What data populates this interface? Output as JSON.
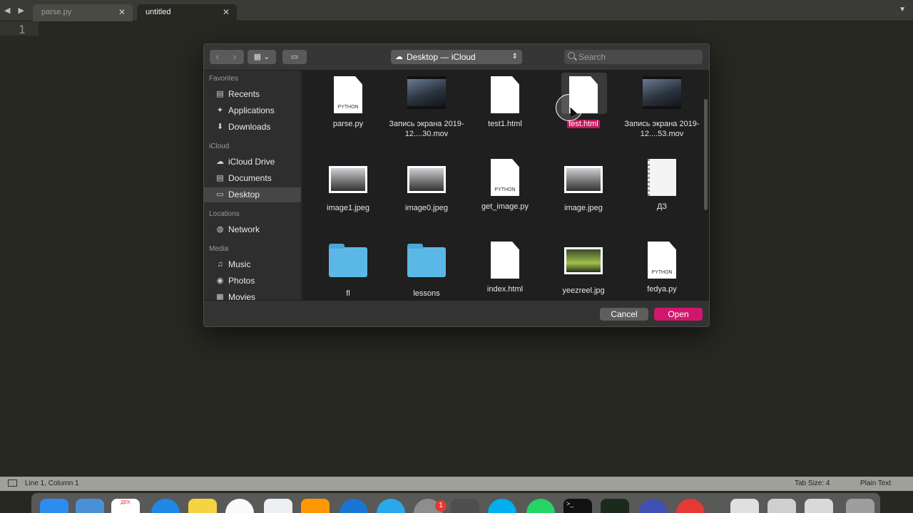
{
  "editor": {
    "tabs": [
      {
        "label": "parse.py",
        "active": false
      },
      {
        "label": "untitled",
        "active": true
      }
    ],
    "line_number": "1",
    "status": {
      "position": "Line 1, Column 1",
      "tab_size": "Tab Size: 4",
      "syntax": "Plain Text"
    }
  },
  "dialog": {
    "location": "Desktop — iCloud",
    "search_placeholder": "Search",
    "sidebar": {
      "sections": [
        {
          "title": "Favorites",
          "items": [
            {
              "label": "Recents",
              "icon": "recents-icon"
            },
            {
              "label": "Applications",
              "icon": "applications-icon"
            },
            {
              "label": "Downloads",
              "icon": "downloads-icon"
            }
          ]
        },
        {
          "title": "iCloud",
          "items": [
            {
              "label": "iCloud Drive",
              "icon": "cloud-icon"
            },
            {
              "label": "Documents",
              "icon": "document-icon"
            },
            {
              "label": "Desktop",
              "icon": "desktop-icon",
              "selected": true
            }
          ]
        },
        {
          "title": "Locations",
          "items": [
            {
              "label": "Network",
              "icon": "network-icon"
            }
          ]
        },
        {
          "title": "Media",
          "items": [
            {
              "label": "Music",
              "icon": "music-icon"
            },
            {
              "label": "Photos",
              "icon": "camera-icon"
            },
            {
              "label": "Movies",
              "icon": "film-icon"
            }
          ]
        }
      ]
    },
    "files": [
      {
        "name": "parse.py",
        "kind": "python",
        "tag": "PYTHON"
      },
      {
        "name": "Запись экрана 2019-12....30.mov",
        "kind": "video"
      },
      {
        "name": "test1.html",
        "kind": "doc"
      },
      {
        "name": "test.html",
        "kind": "doc",
        "selected": true
      },
      {
        "name": "Запись экрана 2019-12....53.mov",
        "kind": "video"
      },
      {
        "name": "image1.jpeg",
        "kind": "image"
      },
      {
        "name": "image0.jpeg",
        "kind": "image"
      },
      {
        "name": "get_image.py",
        "kind": "python",
        "tag": "PYTHON"
      },
      {
        "name": "image.jpeg",
        "kind": "image"
      },
      {
        "name": "ДЗ",
        "kind": "form"
      },
      {
        "name": "fl",
        "kind": "folder"
      },
      {
        "name": "lessons",
        "kind": "folder"
      },
      {
        "name": "index.html",
        "kind": "doc"
      },
      {
        "name": "yeezreel.jpg",
        "kind": "image-green"
      },
      {
        "name": "fedya.py",
        "kind": "python",
        "tag": "PYTHON"
      }
    ],
    "buttons": {
      "cancel": "Cancel",
      "open": "Open"
    },
    "accent": "#d0176d"
  },
  "dock": {
    "calendar_label": "ДЕК",
    "badge_count": "1"
  }
}
